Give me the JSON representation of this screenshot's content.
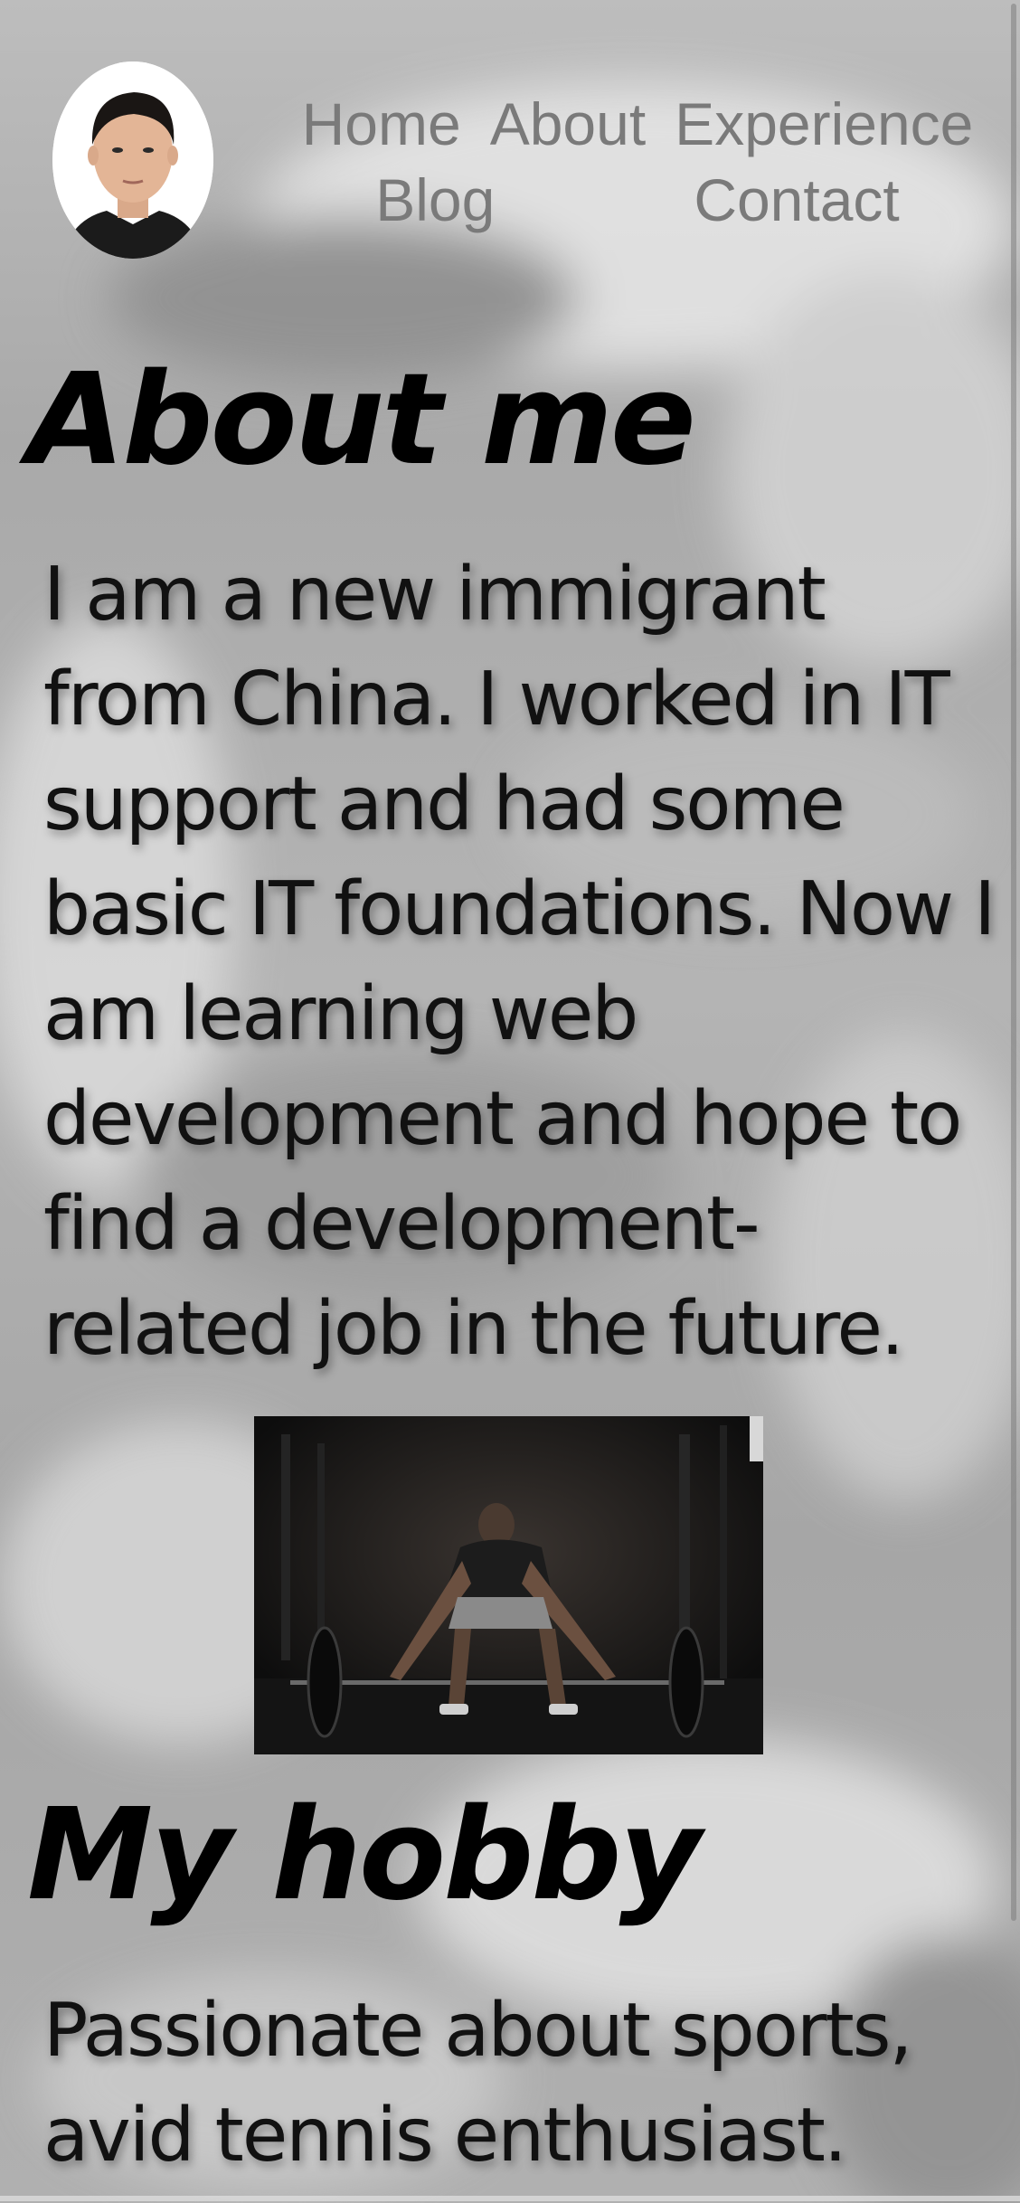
{
  "header": {
    "avatar_alt": "avatar",
    "nav": {
      "row1": [
        "Home",
        "About",
        "Experience"
      ],
      "row2": [
        "Blog",
        "Contact"
      ]
    }
  },
  "about": {
    "heading": "About me",
    "text": "I am a new immigrant from China. I worked in IT support and had some basic IT foundations. Now I am learning web development and hope to find a development-related job in the future."
  },
  "photo": {
    "subject": "weightlifting-photo"
  },
  "hobby": {
    "heading": "My hobby",
    "text": "Passionate about sports, avid tennis enthusiast."
  },
  "colors": {
    "nav_text": "#7a7a7a",
    "heading": "#000000",
    "body_text": "#111111"
  }
}
